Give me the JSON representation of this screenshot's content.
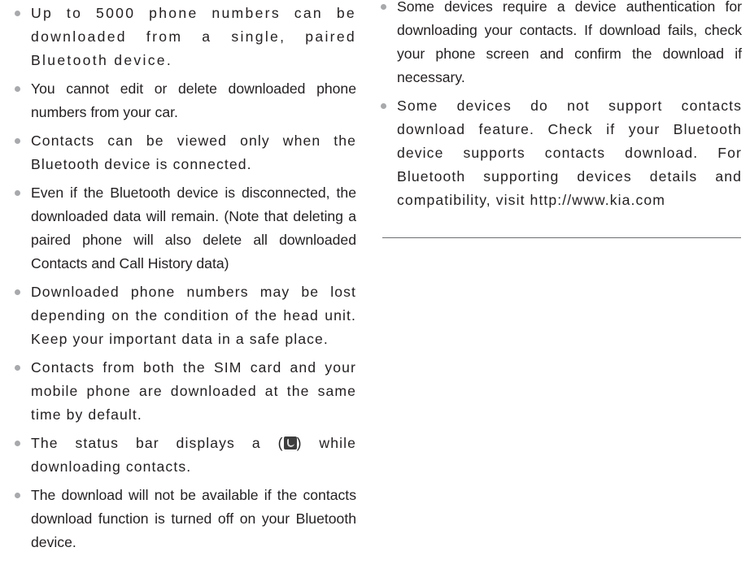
{
  "left_column": {
    "items": [
      "Up to 5000 phone numbers can be downloaded from a single, paired Bluetooth device.",
      "You cannot edit or delete downloaded phone numbers from your car.",
      "Contacts can be viewed only when the Bluetooth device is connected.",
      "Even if the Bluetooth device is disconnected, the downloaded data will remain. (Note that deleting a paired phone will also delete all downloaded Contacts and Call History data)",
      "Downloaded phone numbers may be lost depending on the condition of the head unit. Keep your important data in a safe place.",
      "Contacts from both the SIM card and your mobile phone are downloaded at the same time by default.",
      {
        "before_icon": "The status bar displays a (",
        "icon": "contacts-download-status-icon",
        "after_icon": ") while downloading contacts."
      },
      "The download will not be available if the contacts download function is turned off on your Bluetooth device."
    ]
  },
  "right_column": {
    "items": [
      "Some devices require a device authentication for downloading your contacts. If download fails, check your phone screen and confirm the download if necessary.",
      "Some devices do not support contacts download feature. Check if your Bluetooth device supports contacts download. For Bluetooth supporting devices details and compatibility, visit http://www.kia.com"
    ]
  }
}
